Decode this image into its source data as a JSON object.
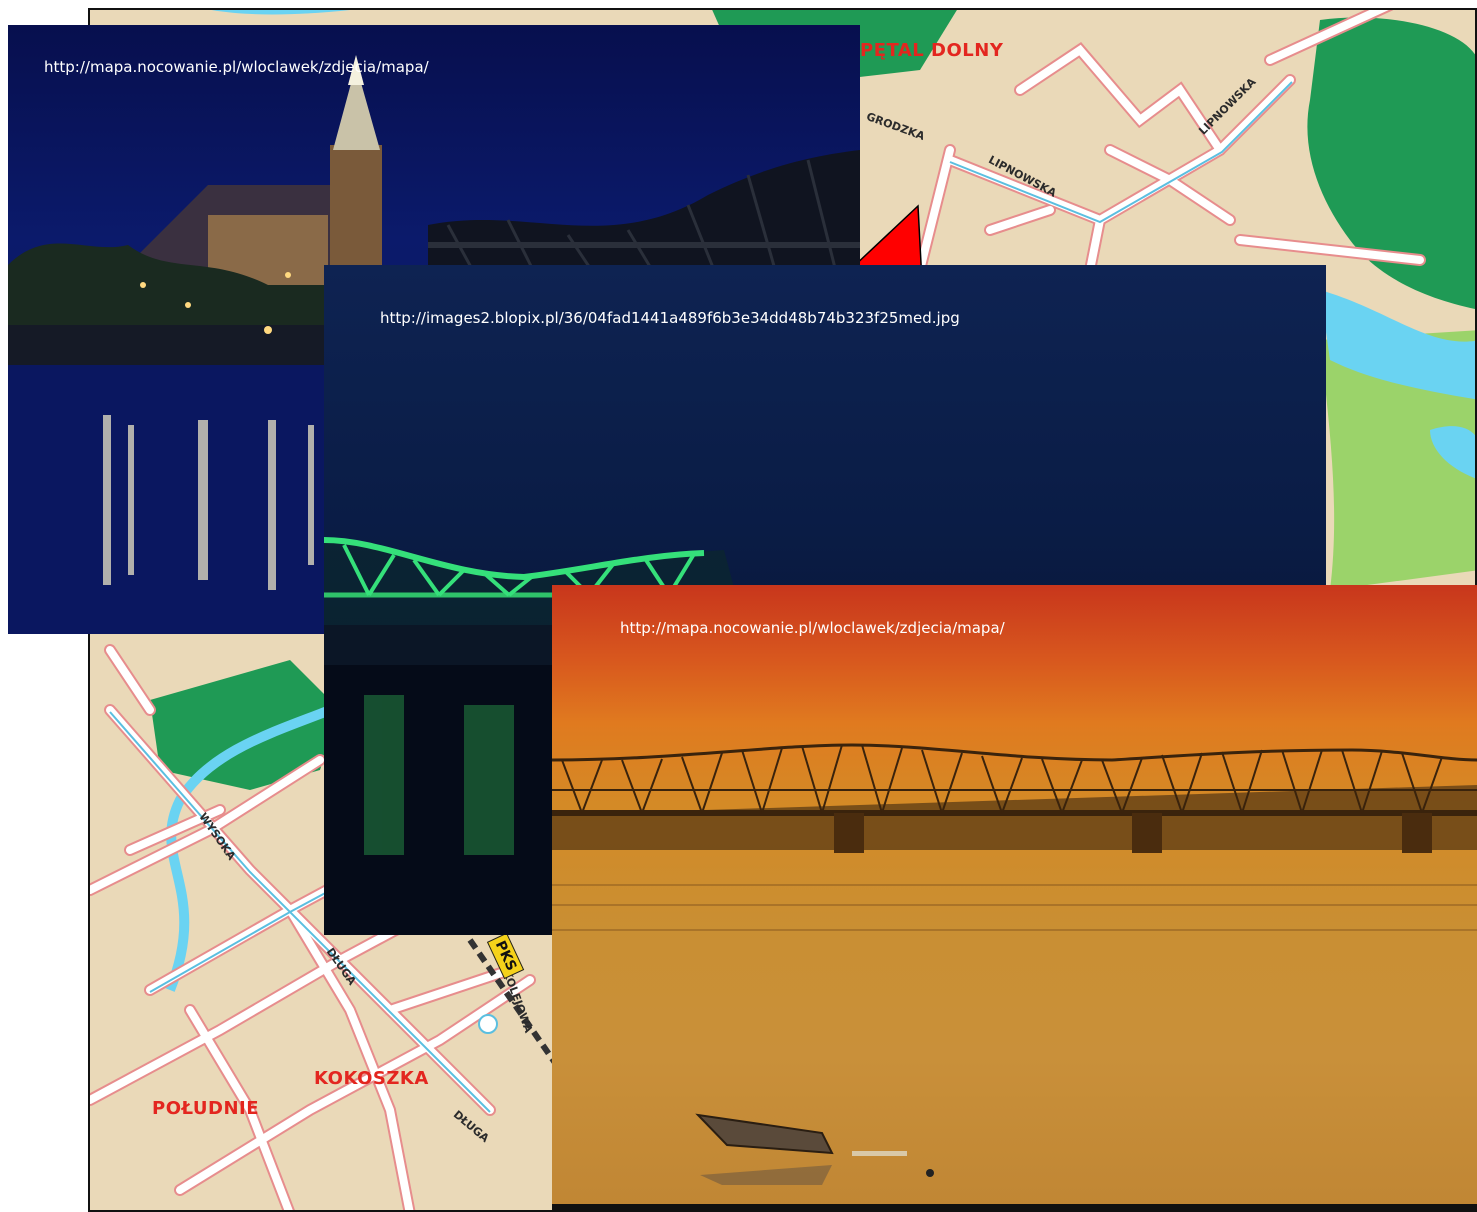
{
  "map": {
    "district_labels": [
      "PĘTAL DOLNY",
      "KOKOSZKA",
      "POŁUDNIE"
    ],
    "street_labels": [
      "LIPNOWSKA",
      "LIPNOWSKA",
      "GRODZKA",
      "WYSOKA",
      "DŁUGA",
      "DŁUGA",
      "KOLEJOWA"
    ],
    "badge": "PKS",
    "colors": {
      "park": "#1f9a55",
      "water": "#6ad3f2",
      "land": "#ead9b8",
      "road": "#ffffff",
      "road_edge": "#e78d8d"
    }
  },
  "photos": [
    {
      "url": "http://mapa.nocowanie.pl/wloclawek/zdjecia/mapa/",
      "scene": "night-cathedral-bridge"
    },
    {
      "url": "http://images2.blopix.pl/36/04fad1441a489f6b3e34dd48b74b323f25med.jpg",
      "scene": "night-green-bridge"
    },
    {
      "url": "http://mapa.nocowanie.pl/wloclawek/zdjecia/mapa/",
      "scene": "sunset-bridge-boat"
    }
  ],
  "pointer": {
    "color": "#ff0000",
    "icon": "red-arrow-pointer"
  }
}
